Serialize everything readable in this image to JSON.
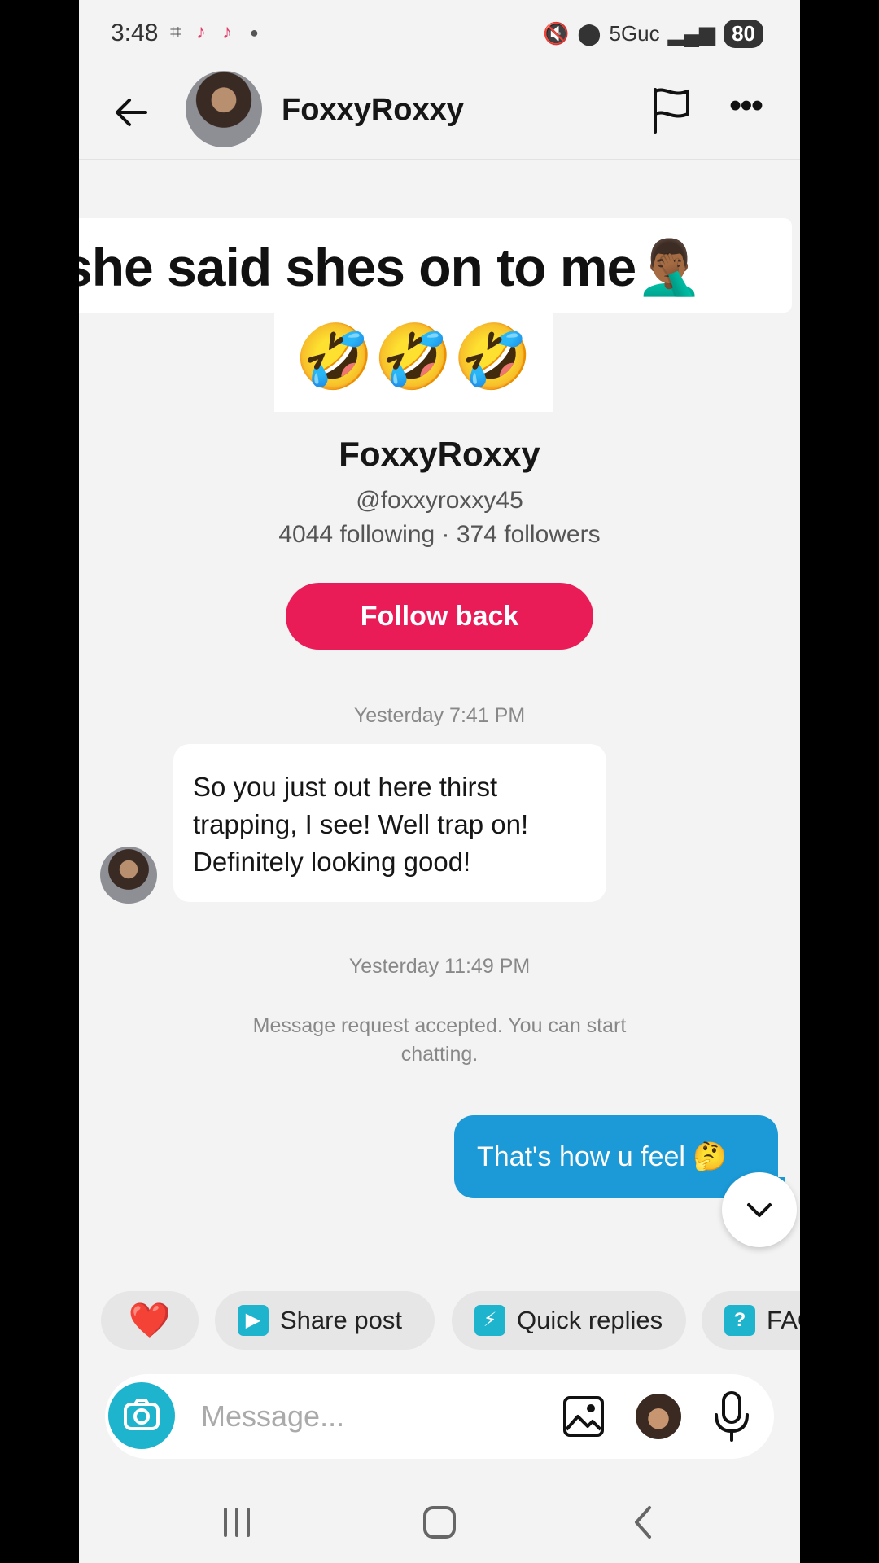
{
  "status_bar": {
    "time": "3:48",
    "left_icons": [
      "screenshot-icon",
      "tiktok-icon",
      "tiktok-icon",
      "dot-icon"
    ],
    "network": "5Guc",
    "battery": "80"
  },
  "header": {
    "name": "FoxxyRoxxy",
    "icons": [
      "back-arrow-icon",
      "flag-icon",
      "more-icon"
    ]
  },
  "caption": {
    "text": "she said shes on to me🤦🏾‍♂️",
    "emojis": "🤣🤣🤣"
  },
  "profile": {
    "name": "FoxxyRoxxy",
    "handle": "@foxxyroxxy45",
    "stats": "4044 following · 374 followers",
    "follow_button": "Follow back"
  },
  "messages": {
    "timestamp_1": "Yesterday 7:41 PM",
    "incoming_text": "So you just out here thirst trapping, I see! Well trap on! Definitely looking good!",
    "timestamp_2": "Yesterday 11:49 PM",
    "system_notice": "Message request accepted. You can start chatting.",
    "outgoing_text": "That's how u feel 🤔",
    "seen_fragment": "n"
  },
  "chips": {
    "heart": "❤️",
    "share_post": "Share post",
    "quick_replies": "Quick replies",
    "faq": "FAQ",
    "faq_icon": "?"
  },
  "input": {
    "placeholder": "Message..."
  },
  "colors": {
    "accent_pink": "#ea1c57",
    "bubble_blue": "#1b9ad7",
    "teal": "#1fb4ce"
  }
}
